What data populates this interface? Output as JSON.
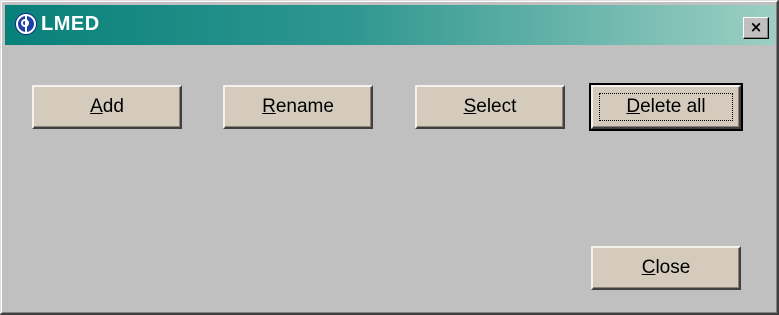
{
  "window": {
    "title": "LMED",
    "app_icon": "lmed-app-icon",
    "close_glyph": "×",
    "titlebar_gradient": [
      "#08807a",
      "#9ccfc3"
    ]
  },
  "buttons": {
    "add": {
      "mnemonic": "A",
      "rest": "dd"
    },
    "rename": {
      "mnemonic": "R",
      "rest": "ename"
    },
    "select": {
      "mnemonic": "S",
      "rest": "elect"
    },
    "delete_all": {
      "mnemonic": "D",
      "rest": "elete all"
    },
    "close": {
      "mnemonic": "C",
      "rest": "lose"
    }
  },
  "focused_button": "delete_all"
}
